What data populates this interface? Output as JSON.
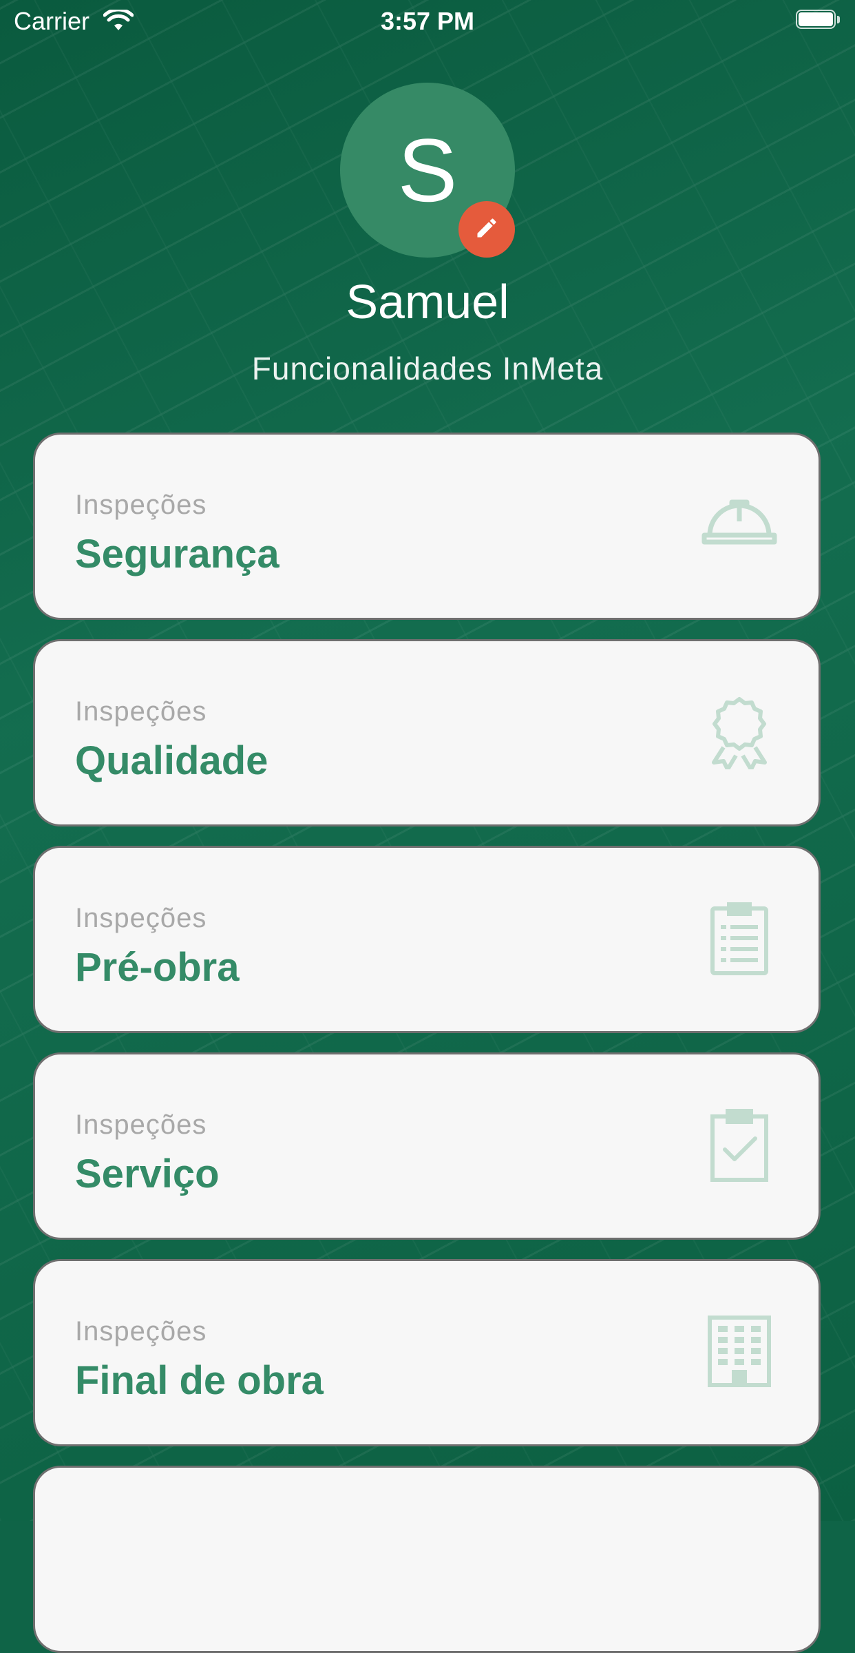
{
  "status_bar": {
    "carrier": "Carrier",
    "time": "3:57 PM",
    "icons": [
      "wifi-icon",
      "battery-icon"
    ]
  },
  "profile": {
    "initial": "S",
    "name": "Samuel",
    "subtitle": "Funcionalidades InMeta",
    "edit_icon": "pencil-icon",
    "avatar_color": "#368a66",
    "edit_color": "#e55b3c"
  },
  "cards": [
    {
      "kicker": "Inspeções",
      "title": "Segurança",
      "icon": "hardhat-icon"
    },
    {
      "kicker": "Inspeções",
      "title": "Qualidade",
      "icon": "award-icon"
    },
    {
      "kicker": "Inspeções",
      "title": "Pré-obra",
      "icon": "clipboard-list-icon"
    },
    {
      "kicker": "Inspeções",
      "title": "Serviço",
      "icon": "clipboard-check-icon"
    },
    {
      "kicker": "Inspeções",
      "title": "Final de obra",
      "icon": "building-icon"
    }
  ],
  "colors": {
    "background": "#0f6447",
    "card": "#f7f7f7",
    "accent": "#348b67",
    "icon": "#c2dccf"
  }
}
